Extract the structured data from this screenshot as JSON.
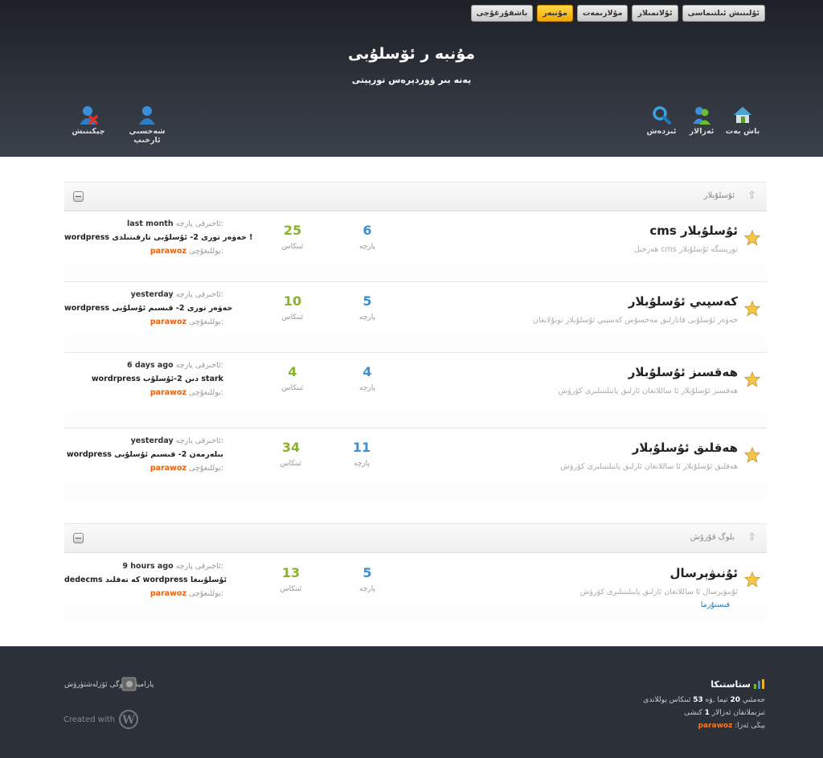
{
  "topnav": [
    {
      "label": "باشقۇرغۇچى",
      "active": false
    },
    {
      "label": "مۇنبەر",
      "active": true
    },
    {
      "label": "مۇلازىمەت",
      "active": false
    },
    {
      "label": "ئۇلانمىلار",
      "active": false
    },
    {
      "label": "ئۇلىنىش ئىلتىماسى",
      "active": false
    }
  ],
  "site": {
    "title": "مۇنبە ر ئۆسلۇبى",
    "tagline": "يەنە بىر ۋوردپرەس تورپېتى"
  },
  "nav": {
    "home": "باش بەت",
    "members": "ئەزالار",
    "search": "ئىزدەش",
    "profile": "شەخسىي ئارخىپ",
    "logout": "چېكىنىش"
  },
  "sections": [
    {
      "title": "ئۇسلۇبلار",
      "forums": [
        {
          "title": "cms ئۇسلۇبلار",
          "desc": "ھەرخىل cms تورپىتىگە ئۇسلۇبلار",
          "topics": "6",
          "posts": "25",
          "topics_label": "پارچە",
          "posts_label": "ئىنكاس",
          "last_time": "last month",
          "last_title": "wordpress خەۋەر تورى 2- ئۇسلۇبى تارقىتىلدى !",
          "last_user": "parawoz"
        },
        {
          "title": "كەسپىي ئۇسلۇبلار",
          "desc": "خەۋەر ئۇسلۇبى قاتارلىق مەخسۇس كەسپىي ئۇسلۇبلار تونۇلانغان",
          "topics": "5",
          "posts": "10",
          "topics_label": "پارچە",
          "posts_label": "ئىنكاس",
          "last_time": "yesterday",
          "last_title": "wordpress خەۋەر تورى 2- قىسىم ئۇسلۇبى",
          "last_user": "parawoz"
        },
        {
          "title": "ھەقسىز ئۇسلۇبلار",
          "desc": "ھەقسىز ئۇسلۇبلار ئا ساللانغان ئارلىق پايىلىنىلىرى كۆرۈش",
          "topics": "4",
          "posts": "4",
          "topics_label": "پارچە",
          "posts_label": "ئىنكاس",
          "last_time": "6 days ago",
          "last_title": "wordrpress دىن 2-ئۇسلۇب stark",
          "last_user": "parawoz"
        },
        {
          "title": "ھەقلىق ئۇسلۇبلار",
          "desc": "ھەقلىق ئۇسلۇبلار ئا ساللانغان ئارلىق پايىلىنىلىرى كۆرۈش",
          "topics": "11",
          "posts": "34",
          "topics_label": "پارچە",
          "posts_label": "ئىنكاس",
          "last_time": "yesterday",
          "last_title": "wordpress بىلەرمەن 2- قىسىم ئۇسلۇبى",
          "last_user": "parawoz"
        }
      ]
    },
    {
      "title": "بلوگ قۇرۇش",
      "forums": [
        {
          "title": "ئۇنىۋېرسال",
          "desc": "ئۇنىۋېرسال ئا ساللانغان ئارلىق پايىلىنىلىرى كۆرۈش",
          "sub": "قىستۇرما",
          "topics": "5",
          "posts": "13",
          "topics_label": "پارچە",
          "posts_label": "ئىنكاس",
          "last_time": "9 hours ago",
          "last_title": "dedecms كە تەقلىد wordpress ئۇسلۇبىغا",
          "last_user": "parawoz"
        }
      ]
    }
  ],
  "labels": {
    "last_reply": "ئاخىرقى پارچە:",
    "author": "يوللىغۇچى:"
  },
  "footer": {
    "powered": "پارامېتىر بلوگى ئۆزلەشتۈرۈش",
    "created_with": "Created with",
    "stats_title": "ستاستىكا",
    "stats_line1_pre": "جەمئىي",
    "topics_count": "20",
    "stats_line1_mid": "تېما ,ۋە",
    "posts_count": "53",
    "stats_line1_post": "ئىنكاس يوللاندى",
    "stats_line2_pre": "تىزىملاتقان ئەزالار",
    "members_count": "1",
    "stats_line2_post": "كىشى",
    "newest_label": "يېڭى ئەزا:",
    "newest_user": "parawoz"
  },
  "colors": {
    "accent": "#8ab22b",
    "blue": "#3b8fd3",
    "user": "#e8620e",
    "active_tab": "#f7b500"
  }
}
